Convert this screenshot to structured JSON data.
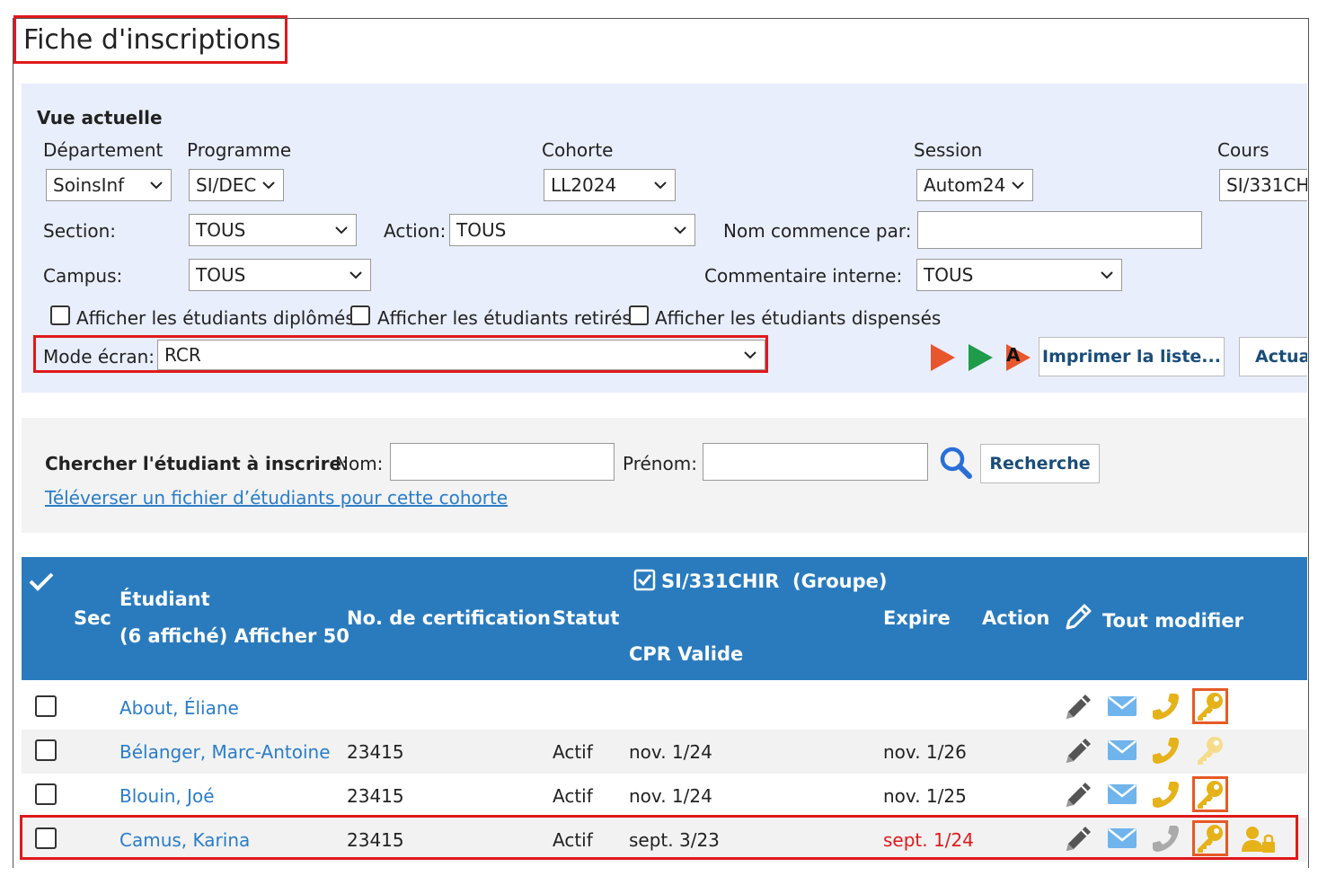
{
  "page": {
    "title": "Fiche d'inscriptions"
  },
  "filters": {
    "section_title": "Vue actuelle",
    "departement": {
      "label": "Département",
      "value": "SoinsInf"
    },
    "programme": {
      "label": "Programme",
      "value": "SI/DEC"
    },
    "cohorte": {
      "label": "Cohorte",
      "value": "LL2024"
    },
    "session": {
      "label": "Session",
      "value": "Autom24"
    },
    "cours": {
      "label": "Cours",
      "value": "SI/331CH"
    },
    "section": {
      "label": "Section:",
      "value": "TOUS"
    },
    "action": {
      "label": "Action:",
      "value": "TOUS"
    },
    "nom_commence": {
      "label": "Nom commence par:",
      "value": ""
    },
    "campus": {
      "label": "Campus:",
      "value": "TOUS"
    },
    "commentaire": {
      "label": "Commentaire interne:",
      "value": "TOUS"
    },
    "checkboxes": [
      {
        "label": "Afficher les étudiants diplômés",
        "checked": false
      },
      {
        "label": "Afficher les étudiants retirés",
        "checked": false
      },
      {
        "label": "Afficher les étudiants dispensés",
        "checked": false
      }
    ],
    "mode": {
      "label": "Mode écran:",
      "value": "RCR"
    },
    "play_a_letter": "A",
    "print_button": "Imprimer la liste...",
    "refresh_button": "Actual"
  },
  "search": {
    "label": "Chercher l'étudiant à inscrire",
    "colon": ":",
    "nom_label": "Nom:",
    "nom_value": "",
    "prenom_label": "Prénom:",
    "prenom_value": "",
    "button": "Recherche",
    "upload_link": "Téléverser un fichier d’étudiants pour cette cohorte"
  },
  "table": {
    "headers": {
      "sec": "Sec",
      "etudiant": "Étudiant",
      "affiche": "(6 affiché) Afficher 50",
      "certif": "No. de certification",
      "statut": "Statut",
      "course": "SI/331CHIR",
      "groupe": "(Groupe)",
      "cpr": "CPR Valide",
      "expire": "Expire",
      "action": "Action",
      "tout_modifier": "Tout modifier"
    },
    "rows": [
      {
        "name": "About, Éliane",
        "certif": "",
        "statut": "",
        "cpr": "",
        "expire": "",
        "expired": false,
        "phone_active": true,
        "key_active": true,
        "key_boxed": true,
        "extra_icon": false
      },
      {
        "name": "Bélanger, Marc-Antoine",
        "certif": "23415",
        "statut": "Actif",
        "cpr": "nov. 1/24",
        "expire": "nov. 1/26",
        "expired": false,
        "phone_active": true,
        "key_active": false,
        "key_boxed": false,
        "extra_icon": false
      },
      {
        "name": "Blouin, Joé",
        "certif": "23415",
        "statut": "Actif",
        "cpr": "nov. 1/24",
        "expire": "nov. 1/25",
        "expired": false,
        "phone_active": true,
        "key_active": true,
        "key_boxed": true,
        "extra_icon": false
      },
      {
        "name": "Camus, Karina",
        "certif": "23415",
        "statut": "Actif",
        "cpr": "sept. 3/23",
        "expire": "sept. 1/24",
        "expired": true,
        "phone_active": false,
        "key_active": true,
        "key_boxed": true,
        "extra_icon": true
      }
    ]
  },
  "colors": {
    "accent": "#2a7bbd",
    "highlight": "#e0191c",
    "link": "#2a7dc9",
    "key": "#e6b21a",
    "mail": "#6fb4ec"
  }
}
